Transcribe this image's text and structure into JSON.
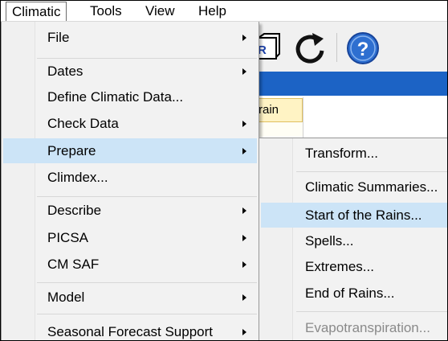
{
  "menubar": {
    "items": [
      "Climatic",
      "Tools",
      "View",
      "Help"
    ],
    "open_item": "Climatic"
  },
  "background": {
    "column_header_fragment": "rain"
  },
  "climatic_menu": {
    "items": [
      {
        "label": "File",
        "submenu": true
      },
      {
        "label": "Dates",
        "submenu": true
      },
      {
        "label": "Define Climatic Data...",
        "submenu": false
      },
      {
        "label": "Check Data",
        "submenu": true
      },
      {
        "label": "Prepare",
        "submenu": true,
        "highlighted": true
      },
      {
        "label": "Climdex...",
        "submenu": false
      },
      {
        "label": "Describe",
        "submenu": true
      },
      {
        "label": "PICSA",
        "submenu": true
      },
      {
        "label": "CM SAF",
        "submenu": true
      },
      {
        "label": "Model",
        "submenu": true
      },
      {
        "label": "Seasonal Forecast Support",
        "submenu": true
      }
    ]
  },
  "prepare_menu": {
    "items": [
      {
        "label": "Transform..."
      },
      {
        "label": "Climatic Summaries..."
      },
      {
        "label": "Start of the Rains...",
        "highlighted": true
      },
      {
        "label": "Spells..."
      },
      {
        "label": "Extremes..."
      },
      {
        "label": "End of Rains..."
      },
      {
        "label": "Evapotranspiration...",
        "disabled": true
      }
    ]
  },
  "colors": {
    "highlight": "#cce4f7",
    "menu_background": "#f2f2f2",
    "title_bar_blue": "#1c63c5",
    "help_icon_blue": "#2e6fd0"
  },
  "icons": [
    "report-icon",
    "refresh-icon",
    "help-icon"
  ]
}
